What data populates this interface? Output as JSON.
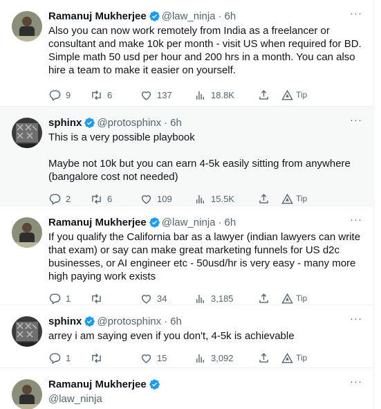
{
  "tweets": [
    {
      "name": "Ramanuj Mukherjee",
      "handle": "@law_ninja",
      "dot": "·",
      "time": "6h",
      "more": "···",
      "text": "Also you can now work remotely from India as a freelancer or consultant and make 10k per month - visit US when required for BD. Simple math 50 usd per hour and 200 hrs in a month. You can also hire a team to make it easier on yourself.",
      "replies": "9",
      "retweets": "6",
      "likes": "137",
      "views": "18.8K",
      "tip": "Tip"
    },
    {
      "name": "sphinx",
      "handle": "@protosphinx",
      "dot": "·",
      "time": "6h",
      "more": "···",
      "text": "This is a very possible playbook\n\nMaybe not 10k but you can earn 4-5k easily sitting from anywhere (bangalore cost not needed)",
      "replies": "2",
      "retweets": "6",
      "likes": "109",
      "views": "15.5K",
      "tip": "Tip"
    },
    {
      "name": "Ramanuj Mukherjee",
      "handle": "@law_ninja",
      "dot": "·",
      "time": "6h",
      "more": "···",
      "text": "If you qualify the California bar as a  lawyer (indian lawyers can write that exam) or say can make great marketing funnels for US d2c businesses, or AI engineer etc - 50usd/hr is very easy - many more high paying work exists",
      "replies": "1",
      "retweets": "",
      "likes": "34",
      "views": "3,185",
      "tip": "Tip"
    },
    {
      "name": "sphinx",
      "handle": "@protosphinx",
      "dot": "·",
      "time": "6h",
      "more": "···",
      "text": "arrey i am saying even if you don't, 4-5k is achievable",
      "replies": "1",
      "retweets": "",
      "likes": "15",
      "views": "3,092",
      "tip": "Tip"
    },
    {
      "name": "Ramanuj Mukherjee",
      "handle": "@law_ninja",
      "more": "···"
    }
  ],
  "colors": {
    "verified": "#1d9bf0",
    "muted": "#536471",
    "text": "#0f1419",
    "highlight_bg": "#f7f9f9"
  }
}
